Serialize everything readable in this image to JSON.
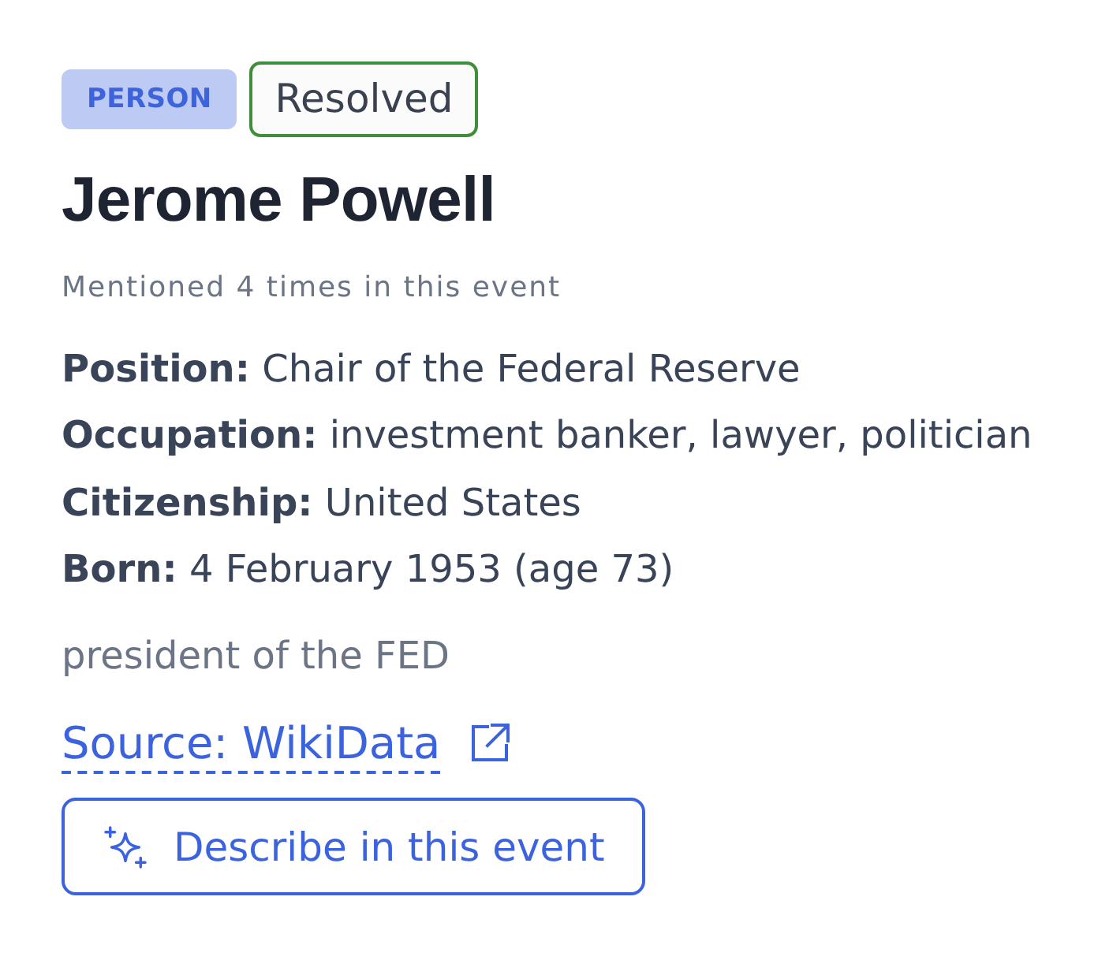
{
  "badge": "PERSON",
  "status": "Resolved",
  "name": "Jerome Powell",
  "mentions": "Mentioned 4 times in this event",
  "facts": [
    "**Position:** Chair of the Federal Reserve",
    "**Occupation:** investment banker, lawyer, politician",
    "**Citizenship:** United States",
    "**Born:** 4 February 1953 (age 73)"
  ],
  "description": "president of the FED",
  "source_link": "Source: WikiData",
  "action_button": "Describe in this event"
}
